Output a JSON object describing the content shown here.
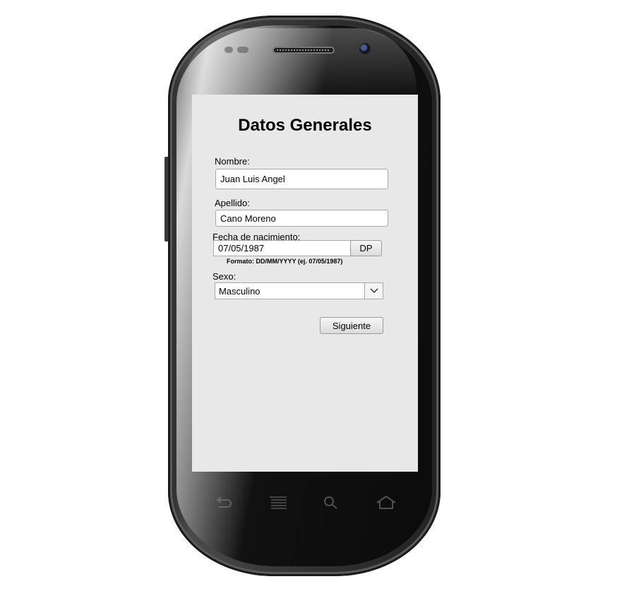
{
  "form": {
    "title": "Datos Generales",
    "nombre_label": "Nombre:",
    "nombre_value": "Juan Luis Angel",
    "apellido_label": "Apellido:",
    "apellido_value": "Cano Moreno",
    "fecha_label": "Fecha de nacimiento:",
    "fecha_value": "07/05/1987",
    "dp_label": "DP",
    "fecha_hint": "Formato: DD/MM/YYYY (ej. 07/05/1987)",
    "sexo_label": "Sexo:",
    "sexo_selected": "Masculino",
    "siguiente_label": "Siguiente"
  },
  "device": {
    "nav_icons": [
      "back-icon",
      "menu-icon",
      "search-icon",
      "home-icon"
    ]
  }
}
